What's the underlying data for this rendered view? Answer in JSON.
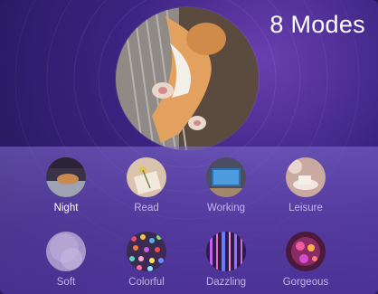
{
  "header": {
    "title": "8 Modes"
  },
  "hero": {
    "image": "cat-on-bed-photo"
  },
  "modes": [
    {
      "label": "Night",
      "selected": true
    },
    {
      "label": "Read",
      "selected": false
    },
    {
      "label": "Working",
      "selected": false
    },
    {
      "label": "Leisure",
      "selected": false
    },
    {
      "label": "Soft",
      "selected": false
    },
    {
      "label": "Colorful",
      "selected": false
    },
    {
      "label": "Dazzling",
      "selected": false
    },
    {
      "label": "Gorgeous",
      "selected": false
    }
  ],
  "colors": {
    "background": "#2a1a5e",
    "label_active": "#ffffff",
    "label_inactive": "#c8bde8"
  }
}
